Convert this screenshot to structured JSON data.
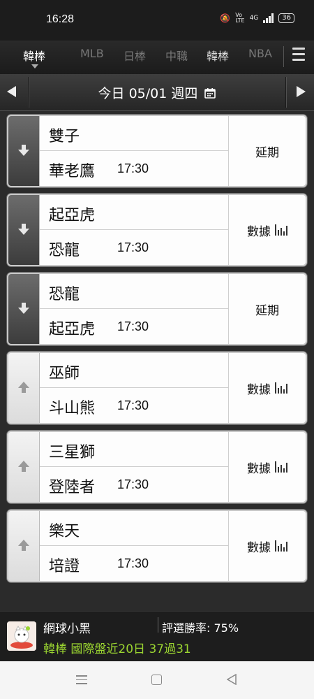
{
  "status_bar": {
    "time": "16:28",
    "network": "4G",
    "battery": "36"
  },
  "tabs": [
    {
      "label": "韓棒",
      "state": "active"
    },
    {
      "label": "MLB",
      "state": "inactive"
    },
    {
      "label": "日棒",
      "state": "inactive"
    },
    {
      "label": "中職",
      "state": "inactive"
    },
    {
      "label": "韓棒",
      "state": "highlighted"
    },
    {
      "label": "NBA",
      "state": "inactive"
    }
  ],
  "date_bar": {
    "label": "今日 05/01 週四"
  },
  "games": [
    {
      "home": "雙子",
      "away": "華老鷹",
      "time": "17:30",
      "status": "延期",
      "trend": "down",
      "show_chart_icon": false
    },
    {
      "home": "起亞虎",
      "away": "恐龍",
      "time": "17:30",
      "status": "數據",
      "trend": "down",
      "show_chart_icon": true
    },
    {
      "home": "恐龍",
      "away": "起亞虎",
      "time": "17:30",
      "status": "延期",
      "trend": "down",
      "show_chart_icon": false
    },
    {
      "home": "巫師",
      "away": "斗山熊",
      "time": "17:30",
      "status": "數據",
      "trend": "up",
      "show_chart_icon": true
    },
    {
      "home": "三星獅",
      "away": "登陸者",
      "time": "17:30",
      "status": "數據",
      "trend": "up",
      "show_chart_icon": true
    },
    {
      "home": "樂天",
      "away": "培證",
      "time": "17:30",
      "status": "數據",
      "trend": "up",
      "show_chart_icon": true
    }
  ],
  "banner": {
    "name": "網球小黑",
    "rate": "評選勝率: 75%",
    "record": "韓棒 國際盤近20日 37過31",
    "record_color": "#9bd531"
  },
  "colors": {
    "accent_green": "#9bd531",
    "card_background": "#fdfdfd",
    "down_side": "#4a4a4a",
    "up_side": "#e8e8e8"
  }
}
